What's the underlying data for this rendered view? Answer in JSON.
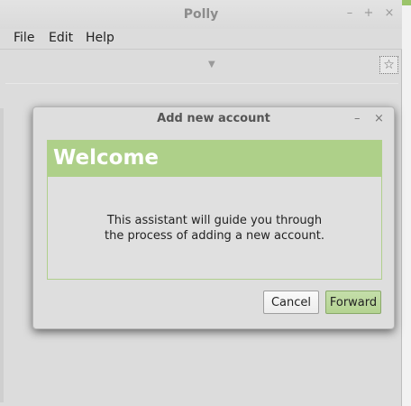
{
  "window": {
    "title": "Polly",
    "controls": {
      "minimize": "–",
      "maximize": "+",
      "close": "×"
    }
  },
  "menu": {
    "items": [
      {
        "label": "File"
      },
      {
        "label": "Edit"
      },
      {
        "label": "Help"
      }
    ]
  },
  "toolbar": {
    "combo_arrow": "▼",
    "star_glyph": "☆"
  },
  "dialog": {
    "title": "Add new account",
    "controls": {
      "minimize": "–",
      "close": "×"
    },
    "heading": "Welcome",
    "body_line1": "This assistant will guide you through",
    "body_line2": "the process of adding a new account.",
    "cancel_label": "Cancel",
    "forward_label": "Forward"
  },
  "colors": {
    "accent_green": "#aed089",
    "forward_button": "#b4d392"
  }
}
